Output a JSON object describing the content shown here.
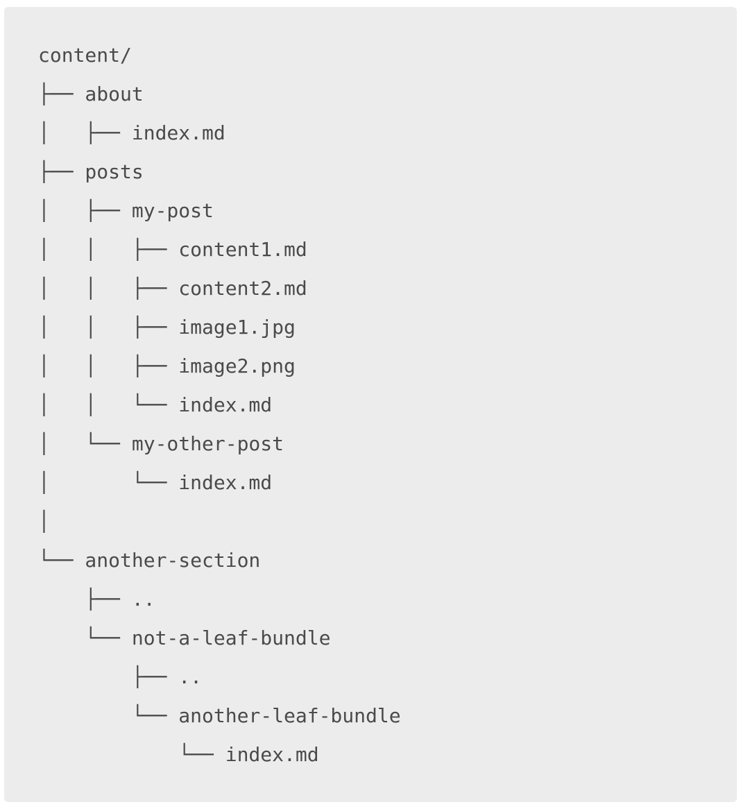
{
  "code_block": {
    "lines": [
      "content/",
      "├── about",
      "│   ├── index.md",
      "├── posts",
      "│   ├── my-post",
      "│   │   ├── content1.md",
      "│   │   ├── content2.md",
      "│   │   ├── image1.jpg",
      "│   │   ├── image2.png",
      "│   │   └── index.md",
      "│   └── my-other-post",
      "│       └── index.md",
      "│",
      "└── another-section",
      "    ├── ..",
      "    └── not-a-leaf-bundle",
      "        ├── ..",
      "        └── another-leaf-bundle",
      "            └── index.md"
    ]
  }
}
